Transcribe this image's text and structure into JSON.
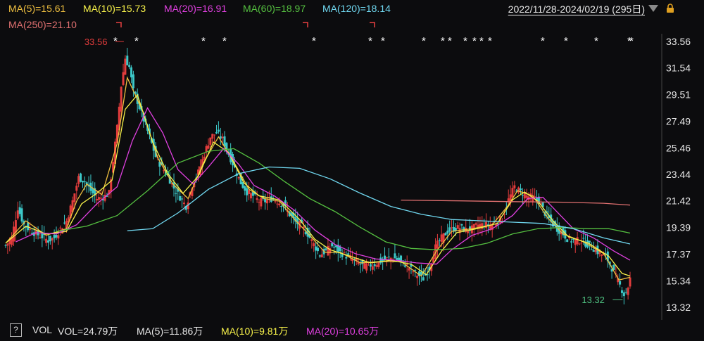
{
  "header": {
    "ma_legend": [
      {
        "label": "MA(5)=15.61",
        "color": "#f0c040"
      },
      {
        "label": "MA(10)=15.73",
        "color": "#f7f24a"
      },
      {
        "label": "MA(20)=16.91",
        "color": "#e040e0"
      },
      {
        "label": "MA(60)=18.97",
        "color": "#55c040"
      },
      {
        "label": "MA(120)=18.14",
        "color": "#70d8f0"
      },
      {
        "label": "MA(250)=21.10",
        "color": "#e07070"
      }
    ],
    "date_range": "2022/11/28-2024/02/19 (295日)",
    "dropdown_icon": "triangle-down-icon",
    "lock_icon": "lock-icon"
  },
  "volume": {
    "help_icon": "?",
    "label": "VOL",
    "vol": "VOL=24.79万",
    "ma5": "MA(5)=11.86万",
    "ma10": "MA(10)=9.81万",
    "ma20": "MA(20)=10.65万",
    "colors": {
      "vol": "#e6e6e6",
      "ma5": "#e6e6e6",
      "ma10": "#f7f24a",
      "ma20": "#e040e0"
    }
  },
  "chart_data": {
    "type": "candlestick",
    "period": "2022/11/28-2024/02/19",
    "bars": 295,
    "y_ticks": [
      33.56,
      31.54,
      29.51,
      27.49,
      25.46,
      23.44,
      21.42,
      19.39,
      17.37,
      15.34,
      13.32
    ],
    "ylim": [
      13.32,
      33.56
    ],
    "annotations": {
      "high": "33.56",
      "low": "13.32"
    },
    "up_color": "#e23c3c",
    "down_color": "#3cc8c8",
    "close_path": [
      [
        0,
        18.0
      ],
      [
        6,
        18.6
      ],
      [
        12,
        20.9
      ],
      [
        18,
        19.6
      ],
      [
        24,
        19.2
      ],
      [
        30,
        18.9
      ],
      [
        36,
        18.7
      ],
      [
        42,
        18.4
      ],
      [
        48,
        18.6
      ],
      [
        54,
        19.3
      ],
      [
        60,
        19.9
      ],
      [
        66,
        21.4
      ],
      [
        72,
        23.2
      ],
      [
        78,
        22.9
      ],
      [
        84,
        22.2
      ],
      [
        90,
        21.6
      ],
      [
        96,
        21.7
      ],
      [
        102,
        22.0
      ],
      [
        106,
        24.5
      ],
      [
        110,
        27.0
      ],
      [
        114,
        30.2
      ],
      [
        118,
        32.3
      ],
      [
        122,
        31.6
      ],
      [
        126,
        29.8
      ],
      [
        130,
        29.0
      ],
      [
        136,
        27.6
      ],
      [
        142,
        26.3
      ],
      [
        148,
        24.8
      ],
      [
        154,
        24.0
      ],
      [
        160,
        23.3
      ],
      [
        166,
        22.4
      ],
      [
        172,
        21.7
      ],
      [
        178,
        21.0
      ],
      [
        184,
        22.6
      ],
      [
        190,
        23.6
      ],
      [
        196,
        25.0
      ],
      [
        202,
        26.3
      ],
      [
        208,
        26.6
      ],
      [
        214,
        26.1
      ],
      [
        220,
        25.0
      ],
      [
        226,
        23.9
      ],
      [
        232,
        22.8
      ],
      [
        238,
        22.1
      ],
      [
        244,
        21.8
      ],
      [
        250,
        21.4
      ],
      [
        256,
        21.4
      ],
      [
        262,
        21.6
      ],
      [
        268,
        21.4
      ],
      [
        274,
        21.1
      ],
      [
        280,
        20.4
      ],
      [
        286,
        19.8
      ],
      [
        292,
        19.5
      ],
      [
        298,
        18.9
      ],
      [
        304,
        18.1
      ],
      [
        310,
        17.3
      ],
      [
        316,
        17.6
      ],
      [
        322,
        18.0
      ],
      [
        328,
        17.6
      ],
      [
        334,
        17.3
      ],
      [
        340,
        17.1
      ],
      [
        346,
        16.8
      ],
      [
        352,
        16.5
      ],
      [
        358,
        16.5
      ],
      [
        364,
        16.6
      ],
      [
        370,
        16.8
      ],
      [
        376,
        17.0
      ],
      [
        382,
        17.1
      ],
      [
        388,
        16.9
      ],
      [
        394,
        16.6
      ],
      [
        400,
        16.2
      ],
      [
        406,
        15.8
      ],
      [
        412,
        15.5
      ],
      [
        418,
        16.3
      ],
      [
        424,
        17.9
      ],
      [
        430,
        18.6
      ],
      [
        436,
        19.1
      ],
      [
        442,
        19.3
      ],
      [
        448,
        19.4
      ],
      [
        454,
        19.2
      ],
      [
        460,
        19.3
      ],
      [
        466,
        19.6
      ],
      [
        472,
        19.6
      ],
      [
        478,
        19.6
      ],
      [
        484,
        19.8
      ],
      [
        490,
        20.1
      ],
      [
        496,
        21.5
      ],
      [
        502,
        22.5
      ],
      [
        508,
        22.1
      ],
      [
        514,
        21.8
      ],
      [
        520,
        21.7
      ],
      [
        526,
        21.4
      ],
      [
        532,
        20.5
      ],
      [
        538,
        19.8
      ],
      [
        544,
        19.3
      ],
      [
        550,
        18.9
      ],
      [
        556,
        18.4
      ],
      [
        562,
        18.4
      ],
      [
        568,
        18.4
      ],
      [
        574,
        18.1
      ],
      [
        580,
        17.8
      ],
      [
        586,
        17.4
      ],
      [
        592,
        17.2
      ],
      [
        598,
        16.3
      ],
      [
        604,
        15.3
      ],
      [
        610,
        14.3
      ],
      [
        613,
        14.6
      ],
      [
        616,
        15.5
      ]
    ],
    "ma_series": [
      {
        "name": "MA(5)",
        "color": "#f0c040",
        "points": [
          [
            0,
            18.2
          ],
          [
            20,
            19.9
          ],
          [
            40,
            18.8
          ],
          [
            60,
            19.3
          ],
          [
            70,
            21.4
          ],
          [
            80,
            22.7
          ],
          [
            95,
            21.9
          ],
          [
            110,
            25.8
          ],
          [
            120,
            30.8
          ],
          [
            135,
            28.3
          ],
          [
            150,
            24.7
          ],
          [
            165,
            22.7
          ],
          [
            180,
            21.6
          ],
          [
            195,
            24.3
          ],
          [
            210,
            26.3
          ],
          [
            225,
            24.4
          ],
          [
            240,
            22.3
          ],
          [
            255,
            21.6
          ],
          [
            270,
            21.4
          ],
          [
            285,
            20.0
          ],
          [
            300,
            18.8
          ],
          [
            315,
            17.5
          ],
          [
            330,
            17.5
          ],
          [
            350,
            16.7
          ],
          [
            370,
            16.8
          ],
          [
            390,
            16.8
          ],
          [
            410,
            15.7
          ],
          [
            425,
            17.6
          ],
          [
            440,
            19.1
          ],
          [
            460,
            19.3
          ],
          [
            480,
            19.6
          ],
          [
            495,
            21.0
          ],
          [
            505,
            22.2
          ],
          [
            520,
            21.8
          ],
          [
            535,
            20.1
          ],
          [
            550,
            18.9
          ],
          [
            570,
            18.3
          ],
          [
            590,
            17.4
          ],
          [
            605,
            15.4
          ],
          [
            616,
            15.6
          ]
        ]
      },
      {
        "name": "MA(10)",
        "color": "#f7f24a",
        "points": [
          [
            0,
            18.2
          ],
          [
            20,
            19.5
          ],
          [
            40,
            18.9
          ],
          [
            60,
            19.1
          ],
          [
            75,
            21.2
          ],
          [
            90,
            22.0
          ],
          [
            105,
            23.0
          ],
          [
            118,
            28.4
          ],
          [
            130,
            29.5
          ],
          [
            145,
            25.9
          ],
          [
            160,
            23.5
          ],
          [
            175,
            22.0
          ],
          [
            190,
            23.3
          ],
          [
            205,
            25.9
          ],
          [
            220,
            25.1
          ],
          [
            235,
            22.8
          ],
          [
            250,
            21.8
          ],
          [
            270,
            21.5
          ],
          [
            290,
            20.0
          ],
          [
            305,
            18.5
          ],
          [
            320,
            17.7
          ],
          [
            340,
            17.2
          ],
          [
            360,
            16.7
          ],
          [
            380,
            16.9
          ],
          [
            400,
            16.6
          ],
          [
            415,
            15.8
          ],
          [
            430,
            17.6
          ],
          [
            445,
            19.0
          ],
          [
            465,
            19.3
          ],
          [
            485,
            19.7
          ],
          [
            500,
            21.5
          ],
          [
            512,
            22.1
          ],
          [
            525,
            21.4
          ],
          [
            540,
            19.9
          ],
          [
            555,
            18.7
          ],
          [
            575,
            18.2
          ],
          [
            595,
            17.2
          ],
          [
            608,
            15.9
          ],
          [
            616,
            15.7
          ]
        ]
      },
      {
        "name": "MA(20)",
        "color": "#e040e0",
        "points": [
          [
            10,
            18.3
          ],
          [
            30,
            19.0
          ],
          [
            50,
            18.9
          ],
          [
            70,
            19.6
          ],
          [
            90,
            21.2
          ],
          [
            110,
            22.5
          ],
          [
            125,
            26.0
          ],
          [
            140,
            28.5
          ],
          [
            155,
            26.6
          ],
          [
            170,
            23.8
          ],
          [
            185,
            22.7
          ],
          [
            200,
            24.0
          ],
          [
            215,
            25.4
          ],
          [
            230,
            24.2
          ],
          [
            245,
            22.6
          ],
          [
            265,
            21.8
          ],
          [
            285,
            20.7
          ],
          [
            305,
            19.2
          ],
          [
            325,
            18.1
          ],
          [
            345,
            17.4
          ],
          [
            365,
            17.0
          ],
          [
            385,
            16.9
          ],
          [
            405,
            16.7
          ],
          [
            425,
            16.6
          ],
          [
            440,
            17.7
          ],
          [
            460,
            18.8
          ],
          [
            480,
            19.3
          ],
          [
            500,
            20.3
          ],
          [
            515,
            21.6
          ],
          [
            530,
            21.7
          ],
          [
            545,
            20.5
          ],
          [
            560,
            19.3
          ],
          [
            580,
            18.6
          ],
          [
            600,
            17.6
          ],
          [
            616,
            16.9
          ]
        ]
      },
      {
        "name": "MA(60)",
        "color": "#55c040",
        "points": [
          [
            50,
            19.1
          ],
          [
            80,
            19.5
          ],
          [
            110,
            20.3
          ],
          [
            140,
            22.2
          ],
          [
            170,
            24.3
          ],
          [
            200,
            25.2
          ],
          [
            225,
            25.4
          ],
          [
            250,
            24.3
          ],
          [
            275,
            22.9
          ],
          [
            300,
            21.6
          ],
          [
            325,
            20.6
          ],
          [
            350,
            19.4
          ],
          [
            375,
            18.3
          ],
          [
            400,
            17.8
          ],
          [
            425,
            17.7
          ],
          [
            450,
            17.8
          ],
          [
            475,
            18.2
          ],
          [
            500,
            18.9
          ],
          [
            525,
            19.3
          ],
          [
            550,
            19.4
          ],
          [
            575,
            19.3
          ],
          [
            595,
            19.3
          ],
          [
            616,
            18.97
          ]
        ]
      },
      {
        "name": "MA(120)",
        "color": "#70d8f0",
        "points": [
          [
            120,
            19.15
          ],
          [
            145,
            19.3
          ],
          [
            170,
            20.5
          ],
          [
            200,
            22.3
          ],
          [
            230,
            23.5
          ],
          [
            260,
            24.0
          ],
          [
            290,
            23.9
          ],
          [
            320,
            23.1
          ],
          [
            350,
            22.0
          ],
          [
            380,
            21.0
          ],
          [
            410,
            20.4
          ],
          [
            440,
            20.0
          ],
          [
            470,
            19.9
          ],
          [
            500,
            19.8
          ],
          [
            530,
            19.7
          ],
          [
            560,
            19.3
          ],
          [
            590,
            18.6
          ],
          [
            616,
            18.14
          ]
        ]
      },
      {
        "name": "MA(250)",
        "color": "#e07070",
        "points": [
          [
            390,
            21.48
          ],
          [
            450,
            21.42
          ],
          [
            500,
            21.36
          ],
          [
            550,
            21.32
          ],
          [
            590,
            21.24
          ],
          [
            616,
            21.1
          ]
        ]
      }
    ]
  }
}
